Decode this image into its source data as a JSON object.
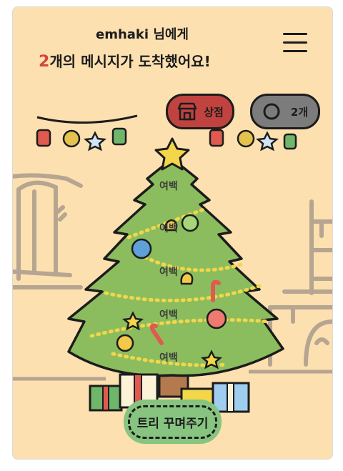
{
  "header": {
    "recipient": "emhaki 님에게",
    "message_count": "2",
    "message_suffix": "개의 메시지가 도착했어요!"
  },
  "shop": {
    "label": "상점",
    "icon": "shop-icon"
  },
  "coins": {
    "label": "2개",
    "icon": "coin-icon"
  },
  "tree": {
    "slots": [
      {
        "label": "여백"
      },
      {
        "label": "여백"
      },
      {
        "label": "여백"
      },
      {
        "label": "여백"
      },
      {
        "label": "여백"
      }
    ]
  },
  "decorate_button": {
    "label": "트리 꾸며주기"
  },
  "colors": {
    "background": "#fde0b0",
    "shop_button": "#c0433f",
    "coin_button": "#7c7c7c",
    "decorate_button": "#86c47f",
    "tree": "#8bbd5e",
    "accent_number": "#d2473d"
  }
}
